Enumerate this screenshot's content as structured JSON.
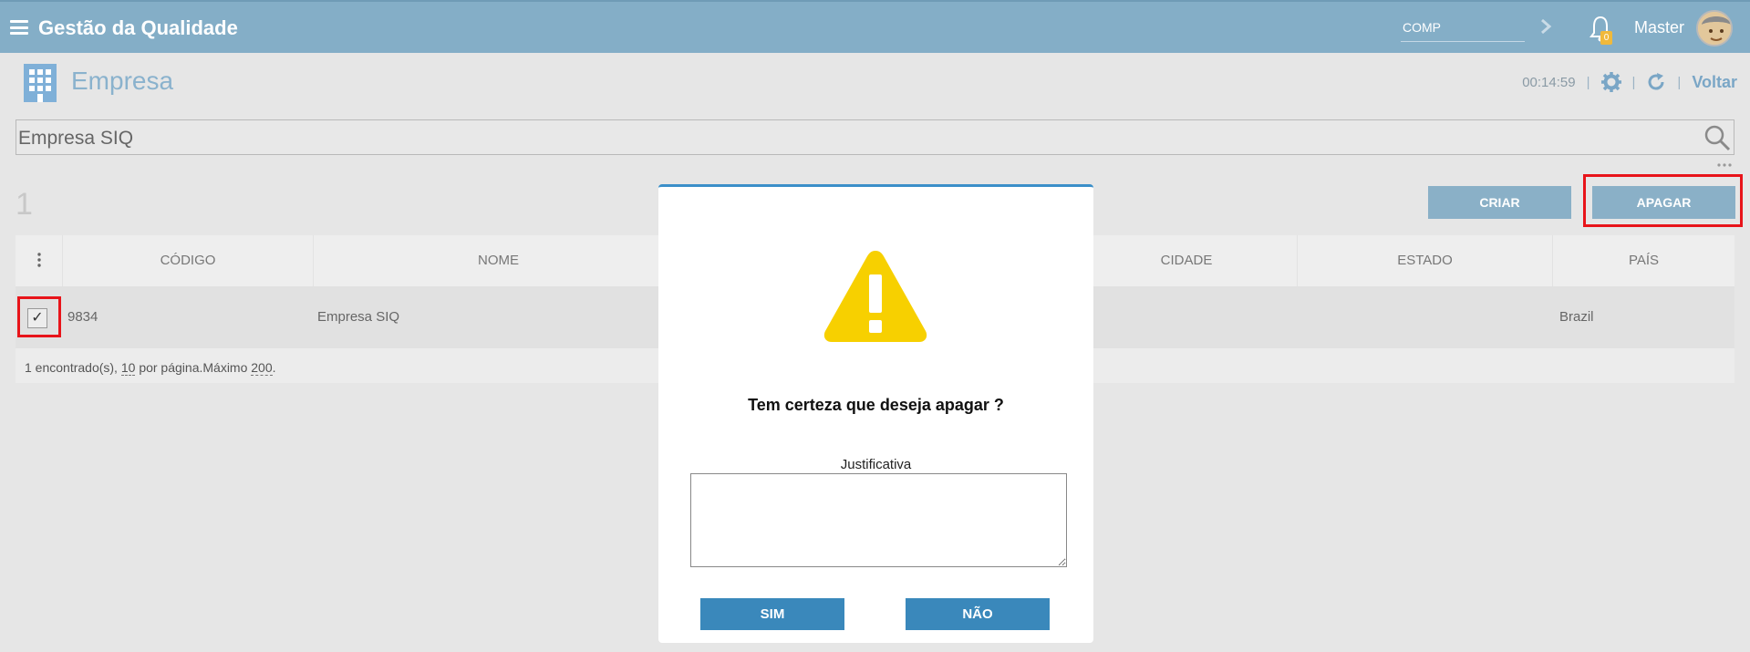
{
  "topbar": {
    "app_title": "Gestão da Qualidade",
    "comp_value": "COMP",
    "notification_count": "0",
    "user_name": "Master"
  },
  "page": {
    "title": "Empresa",
    "timer": "00:14:59",
    "back_label": "Voltar"
  },
  "search": {
    "value": "Empresa SIQ"
  },
  "list": {
    "count": "1",
    "create_label": "CRIAR",
    "delete_label": "APAGAR",
    "columns": [
      "CÓDIGO",
      "NOME",
      "CIDADE",
      "ESTADO",
      "PAÍS"
    ],
    "rows": [
      {
        "codigo": "9834",
        "nome": "Empresa SIQ",
        "cidade": "",
        "estado": "",
        "pais": "Brazil",
        "checked": "✓"
      }
    ],
    "footer": {
      "found": "1 encontrado(s),",
      "per_page_value": "10",
      "per_page_text": "por página.Máximo",
      "max_value": "200",
      "end": "."
    }
  },
  "modal": {
    "question": "Tem certeza que deseja apagar ?",
    "justification_label": "Justificativa",
    "justification_value": "",
    "yes_label": "SIM",
    "no_label": "NÃO"
  },
  "colors": {
    "topbar": "#84aec7",
    "accent": "#3a88bb",
    "highlight": "#e8141a",
    "warning": "#f7d000"
  }
}
